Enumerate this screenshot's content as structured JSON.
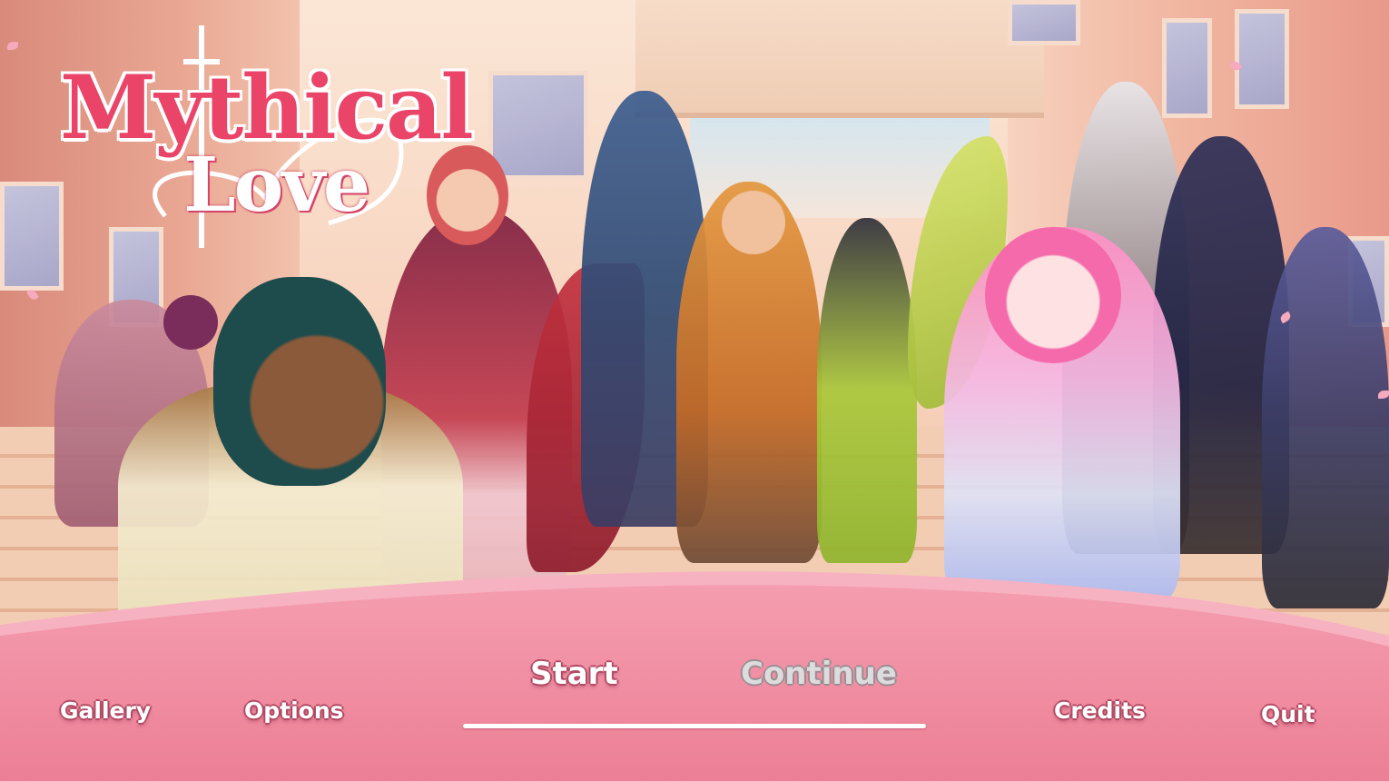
{
  "logo": {
    "word_1": "Mythical",
    "word_2": "Love"
  },
  "menu": {
    "gallery": "Gallery",
    "options": "Options",
    "start": "Start",
    "continue": "Continue",
    "credits": "Credits",
    "quit": "Quit"
  },
  "colors": {
    "panel_pink": "#ef8a9e",
    "logo_red": "#ea4468",
    "continue_disabled": "#dcdcdc"
  }
}
